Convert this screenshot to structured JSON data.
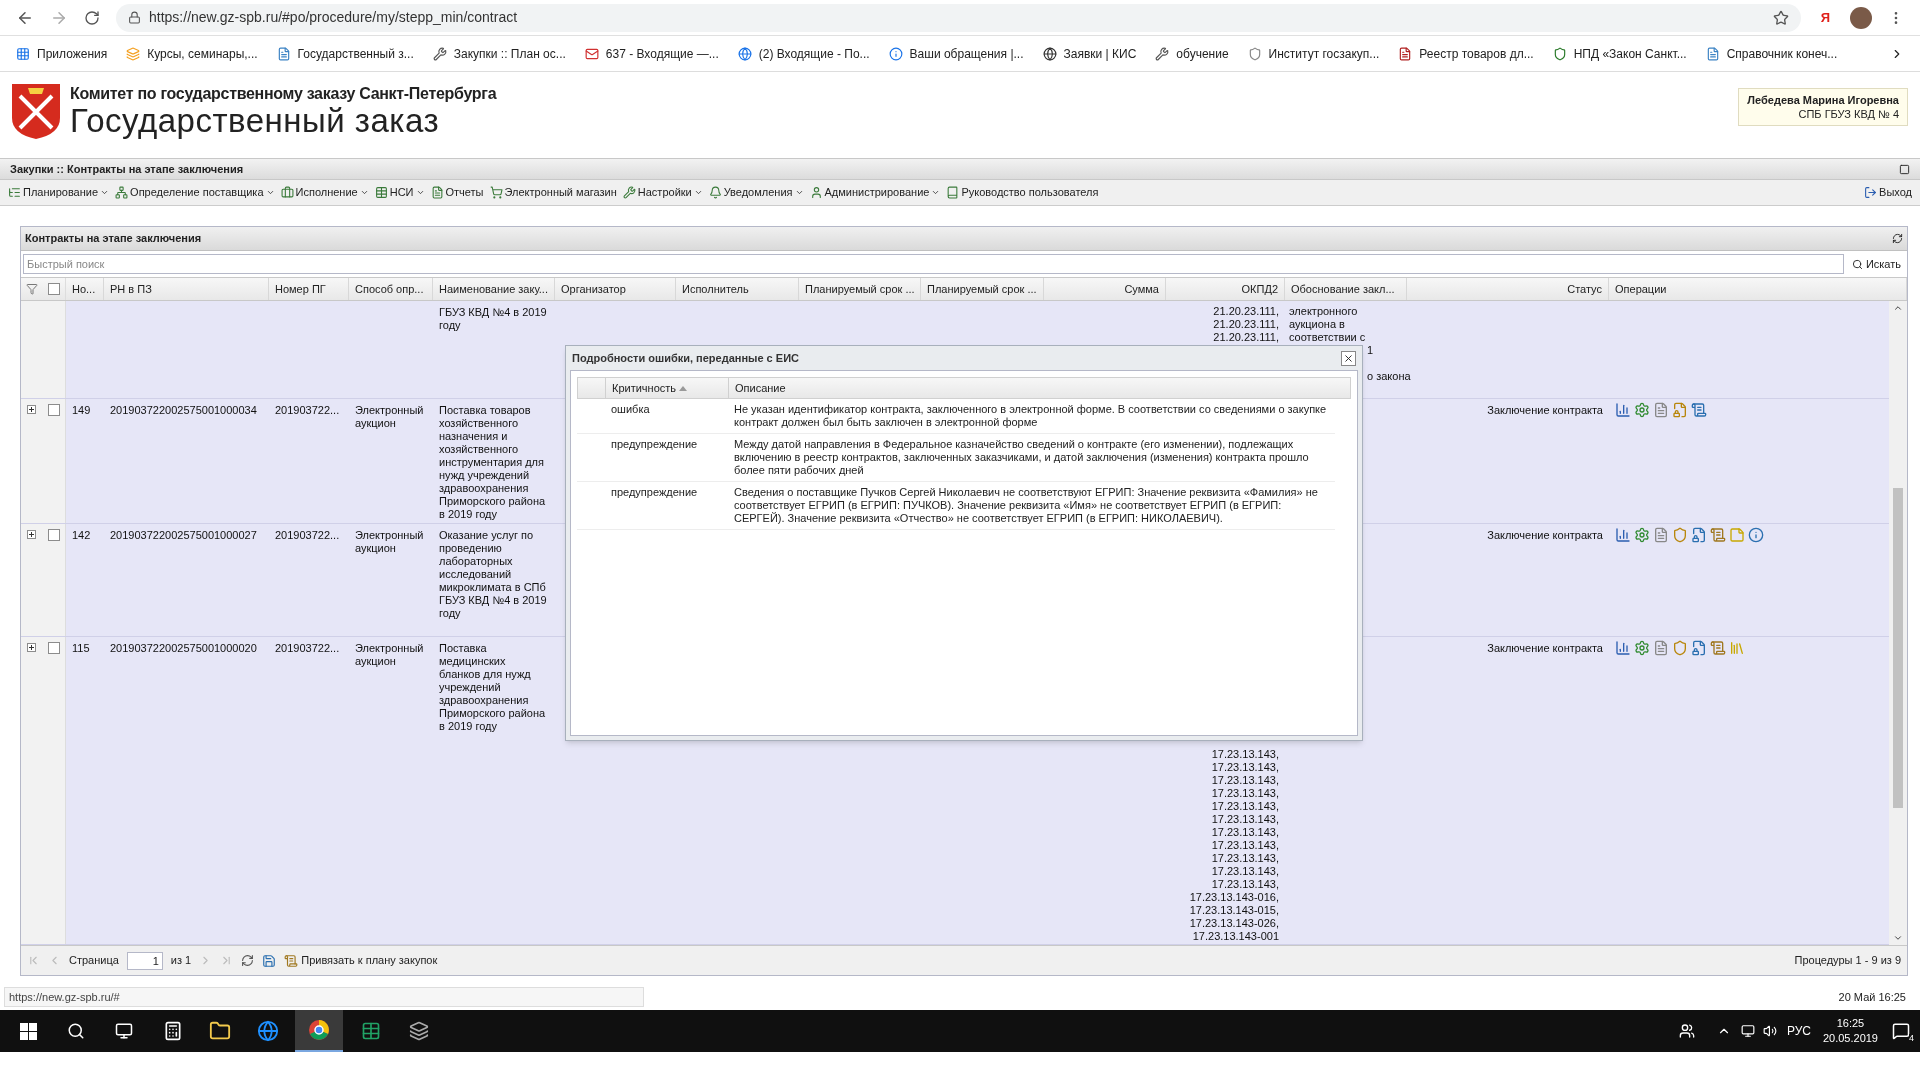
{
  "browser": {
    "url": "https://new.gz-spb.ru/#po/procedure/my/stepp_min/contract",
    "extension": "Я",
    "bookmarks": [
      "Приложения",
      "Курсы, семинары,...",
      "Государственный з...",
      "Закупки :: План ос...",
      "637 - Входящие —...",
      "(2) Входящие - По...",
      "Ваши обращения |...",
      "Заявки | КИС",
      "обучение",
      "Институт госзакуп...",
      "Реестр товаров дл...",
      "НПД «Закон Санкт...",
      "Справочник конеч..."
    ]
  },
  "header": {
    "org": "Комитет по государственному заказу Санкт-Петербурга",
    "title": "Государственный заказ",
    "user": {
      "name": "Лебедева Марина Игоревна",
      "org": "СПБ ГБУЗ КВД № 4"
    }
  },
  "breadcrumb": "Закупки :: Контракты на этапе заключения",
  "menu": [
    {
      "label": "Планирование",
      "dropdown": true
    },
    {
      "label": "Определение поставщика",
      "dropdown": true
    },
    {
      "label": "Исполнение",
      "dropdown": true
    },
    {
      "label": "НСИ",
      "dropdown": true
    },
    {
      "label": "Отчеты",
      "dropdown": false
    },
    {
      "label": "Электронный магазин",
      "dropdown": false
    },
    {
      "label": "Настройки",
      "dropdown": true
    },
    {
      "label": "Уведомления",
      "dropdown": true
    },
    {
      "label": "Администрирование",
      "dropdown": true
    },
    {
      "label": "Руководство пользователя",
      "dropdown": false
    }
  ],
  "logout": "Выход",
  "panel": {
    "title": "Контракты на этапе заключения",
    "search": {
      "placeholder": "Быстрый поиск",
      "button": "Искать"
    },
    "header_checkbox": {
      "checked": false
    },
    "columns": [
      "Но...",
      "РН в ПЗ",
      "Номер ПГ",
      "Способ опр...",
      "Наименование заку...",
      "Организатор",
      "Исполнитель",
      "Планируемый срок ...",
      "Планируемый срок ...",
      "Сумма",
      "ОКПД2",
      "Обоснование закл...",
      "Статус",
      "Операции"
    ],
    "rows": [
      {
        "kind": "partial",
        "name": "ГБУЗ КВД №4 в 2019 году",
        "okpd2": [
          "21.20.23.111,",
          "21.20.23.111,",
          "21.20.23.111,"
        ],
        "justification": [
          "электронного",
          "аукциона в",
          "соответствии с"
        ],
        "justification_fragments": [
          "1",
          "о закона"
        ]
      },
      {
        "kind": "full",
        "expanded": false,
        "checked": false,
        "no": "149",
        "rn": "201903722002575001000034",
        "pg": "201903722...",
        "method": "Электронный аукцион",
        "name": "Поставка товаров хозяйственного назначения и хозяйственного инструментария для нужд учреждений здравоохранения Приморского района в 2019 году",
        "status": "Заключение контракта"
      },
      {
        "kind": "full",
        "expanded": false,
        "checked": false,
        "no": "142",
        "rn": "201903722002575001000027",
        "pg": "201903722...",
        "method": "Электронный аукцион",
        "name": "Оказание услуг по проведению лабораторных исследований микроклимата в СПб ГБУЗ КВД №4 в 2019 году",
        "status": "Заключение контракта"
      },
      {
        "kind": "full",
        "expanded": false,
        "checked": false,
        "no": "115",
        "rn": "201903722002575001000020",
        "pg": "201903722...",
        "method": "Электронный аукцион",
        "name": "Поставка медицинских бланков для нужд учреждений здравоохранения Приморского района в 2019 году",
        "status": "Заключение контракта",
        "okpd2": [
          "17.23.13.143,",
          "17.23.13.143,",
          "17.23.13.143,",
          "17.23.13.143,",
          "17.23.13.143,",
          "17.23.13.143,",
          "17.23.13.143,",
          "17.23.13.143,",
          "17.23.13.143,",
          "17.23.13.143,",
          "17.23.13.143,",
          "17.23.13.143-016,",
          "17.23.13.143-015,",
          "17.23.13.143-026,",
          "17.23.13.143-001"
        ]
      }
    ],
    "pager": {
      "page_label": "Страница",
      "page": "1",
      "of": "из 1",
      "bind_button": "Привязать к плану закупок",
      "summary": "Процедуры 1 - 9 из 9"
    }
  },
  "dialog": {
    "title": "Подробности ошибки, переданные с ЕИС",
    "columns": [
      "Критичность",
      "Описание"
    ],
    "rows": [
      {
        "severity": "ошибка",
        "description": "Не указан идентификатор контракта, заключенного в электронной форме. В соответствии со сведениями о закупке контракт должен был быть заключен в электронной форме"
      },
      {
        "severity": "предупреждение",
        "description": "Между датой направления в Федеральное казначейство сведений о контракте (его изменении), подлежащих включению в реестр контрактов, заключенных заказчиками, и датой заключения (изменения) контракта прошло более пяти рабочих дней"
      },
      {
        "severity": "предупреждение",
        "description": "Сведения о поставщике Пучков Сергей Николаевич не соответствуют ЕГРИП: Значение реквизита «Фамилия» не соответствует ЕГРИП (в ЕГРИП: ПУЧКОВ). Значение реквизита «Имя» не соответствует ЕГРИП (в ЕГРИП: СЕРГЕЙ). Значение реквизита «Отчество» не соответствует ЕГРИП (в ЕГРИП: НИКОЛАЕВИЧ)."
      }
    ]
  },
  "status_bar": {
    "url": "https://new.gz-spb.ru/#",
    "datetime": "20 Май 16:25"
  },
  "taskbar": {
    "language": "РУС",
    "time": "16:25",
    "date": "20.05.2019",
    "notifications": "4"
  }
}
